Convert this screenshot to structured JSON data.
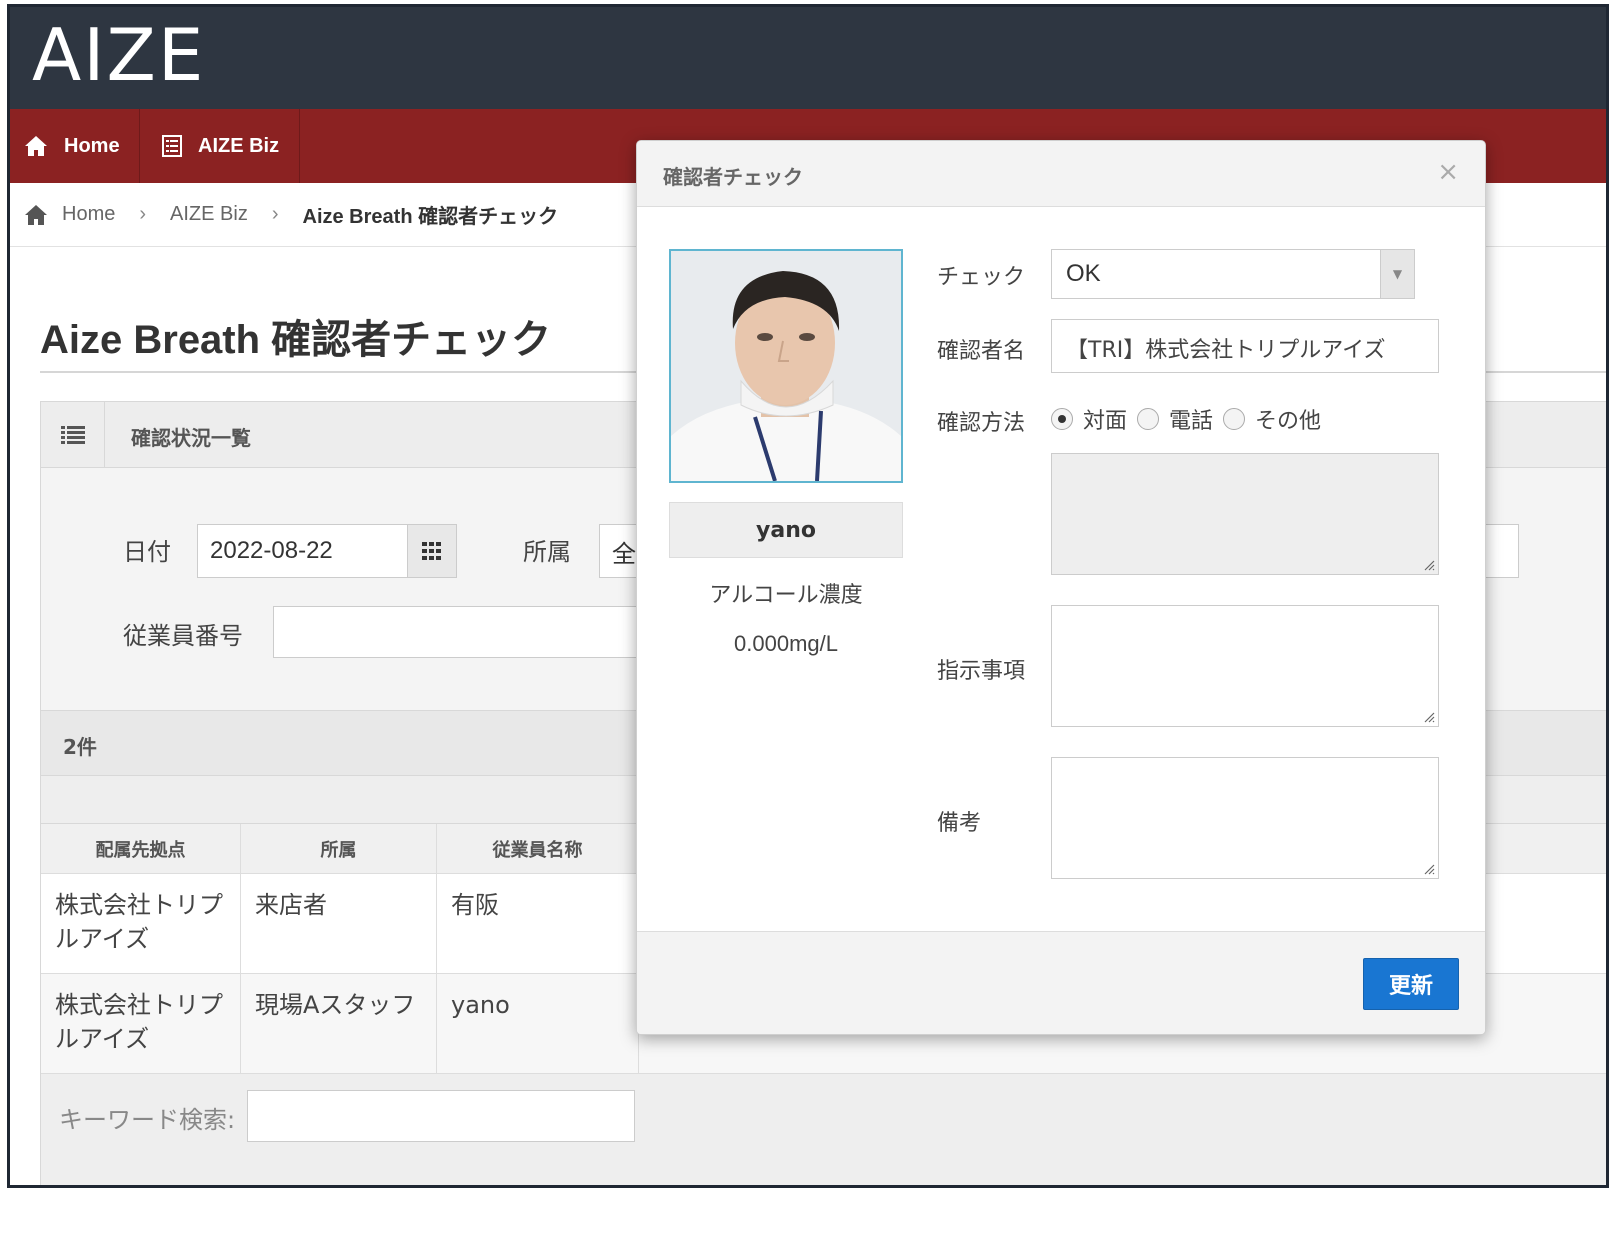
{
  "header": {
    "logo": "AIZE"
  },
  "nav": {
    "home_label": "Home",
    "biz_label": "AIZE Biz"
  },
  "breadcrumb": {
    "home": "Home",
    "biz": "AIZE Biz",
    "current": "Aize Breath 確認者チェック",
    "separator": "›"
  },
  "page": {
    "title": "Aize Breath 確認者チェック"
  },
  "panel": {
    "heading": "確認状況一覧",
    "filters": {
      "date_label": "日付",
      "date_value": "2022-08-22",
      "dept_label": "所属",
      "dept_value": "全",
      "employee_no_label": "従業員番号",
      "employee_no_value": ""
    },
    "count": "2件",
    "columns": [
      "配属先拠点",
      "所属",
      "従業員名称"
    ],
    "rows": [
      {
        "site": "株式会社トリプルアイズ",
        "dept": "来店者",
        "name": "有阪"
      },
      {
        "site": "株式会社トリプルアイズ",
        "dept": "現場Aスタッフ",
        "name": "yano"
      }
    ],
    "search_label": "キーワード検索:",
    "search_value": ""
  },
  "modal": {
    "title": "確認者チェック",
    "close": "×",
    "person_name": "yano",
    "alcohol_label": "アルコール濃度",
    "alcohol_value": "0.000mg/L",
    "check_label": "チェック",
    "check_value": "OK",
    "confirmer_label": "確認者名",
    "confirmer_value": "【TRI】株式会社トリプルアイズ",
    "method_label": "確認方法",
    "method_options": [
      "対面",
      "電話",
      "その他"
    ],
    "method_selected": "対面",
    "instruction_label": "指示事項",
    "remarks_label": "備考",
    "update_button": "更新"
  },
  "colors": {
    "header_bg": "#2e3641",
    "nav_bg": "#8b2222",
    "primary_button": "#1976d2"
  }
}
